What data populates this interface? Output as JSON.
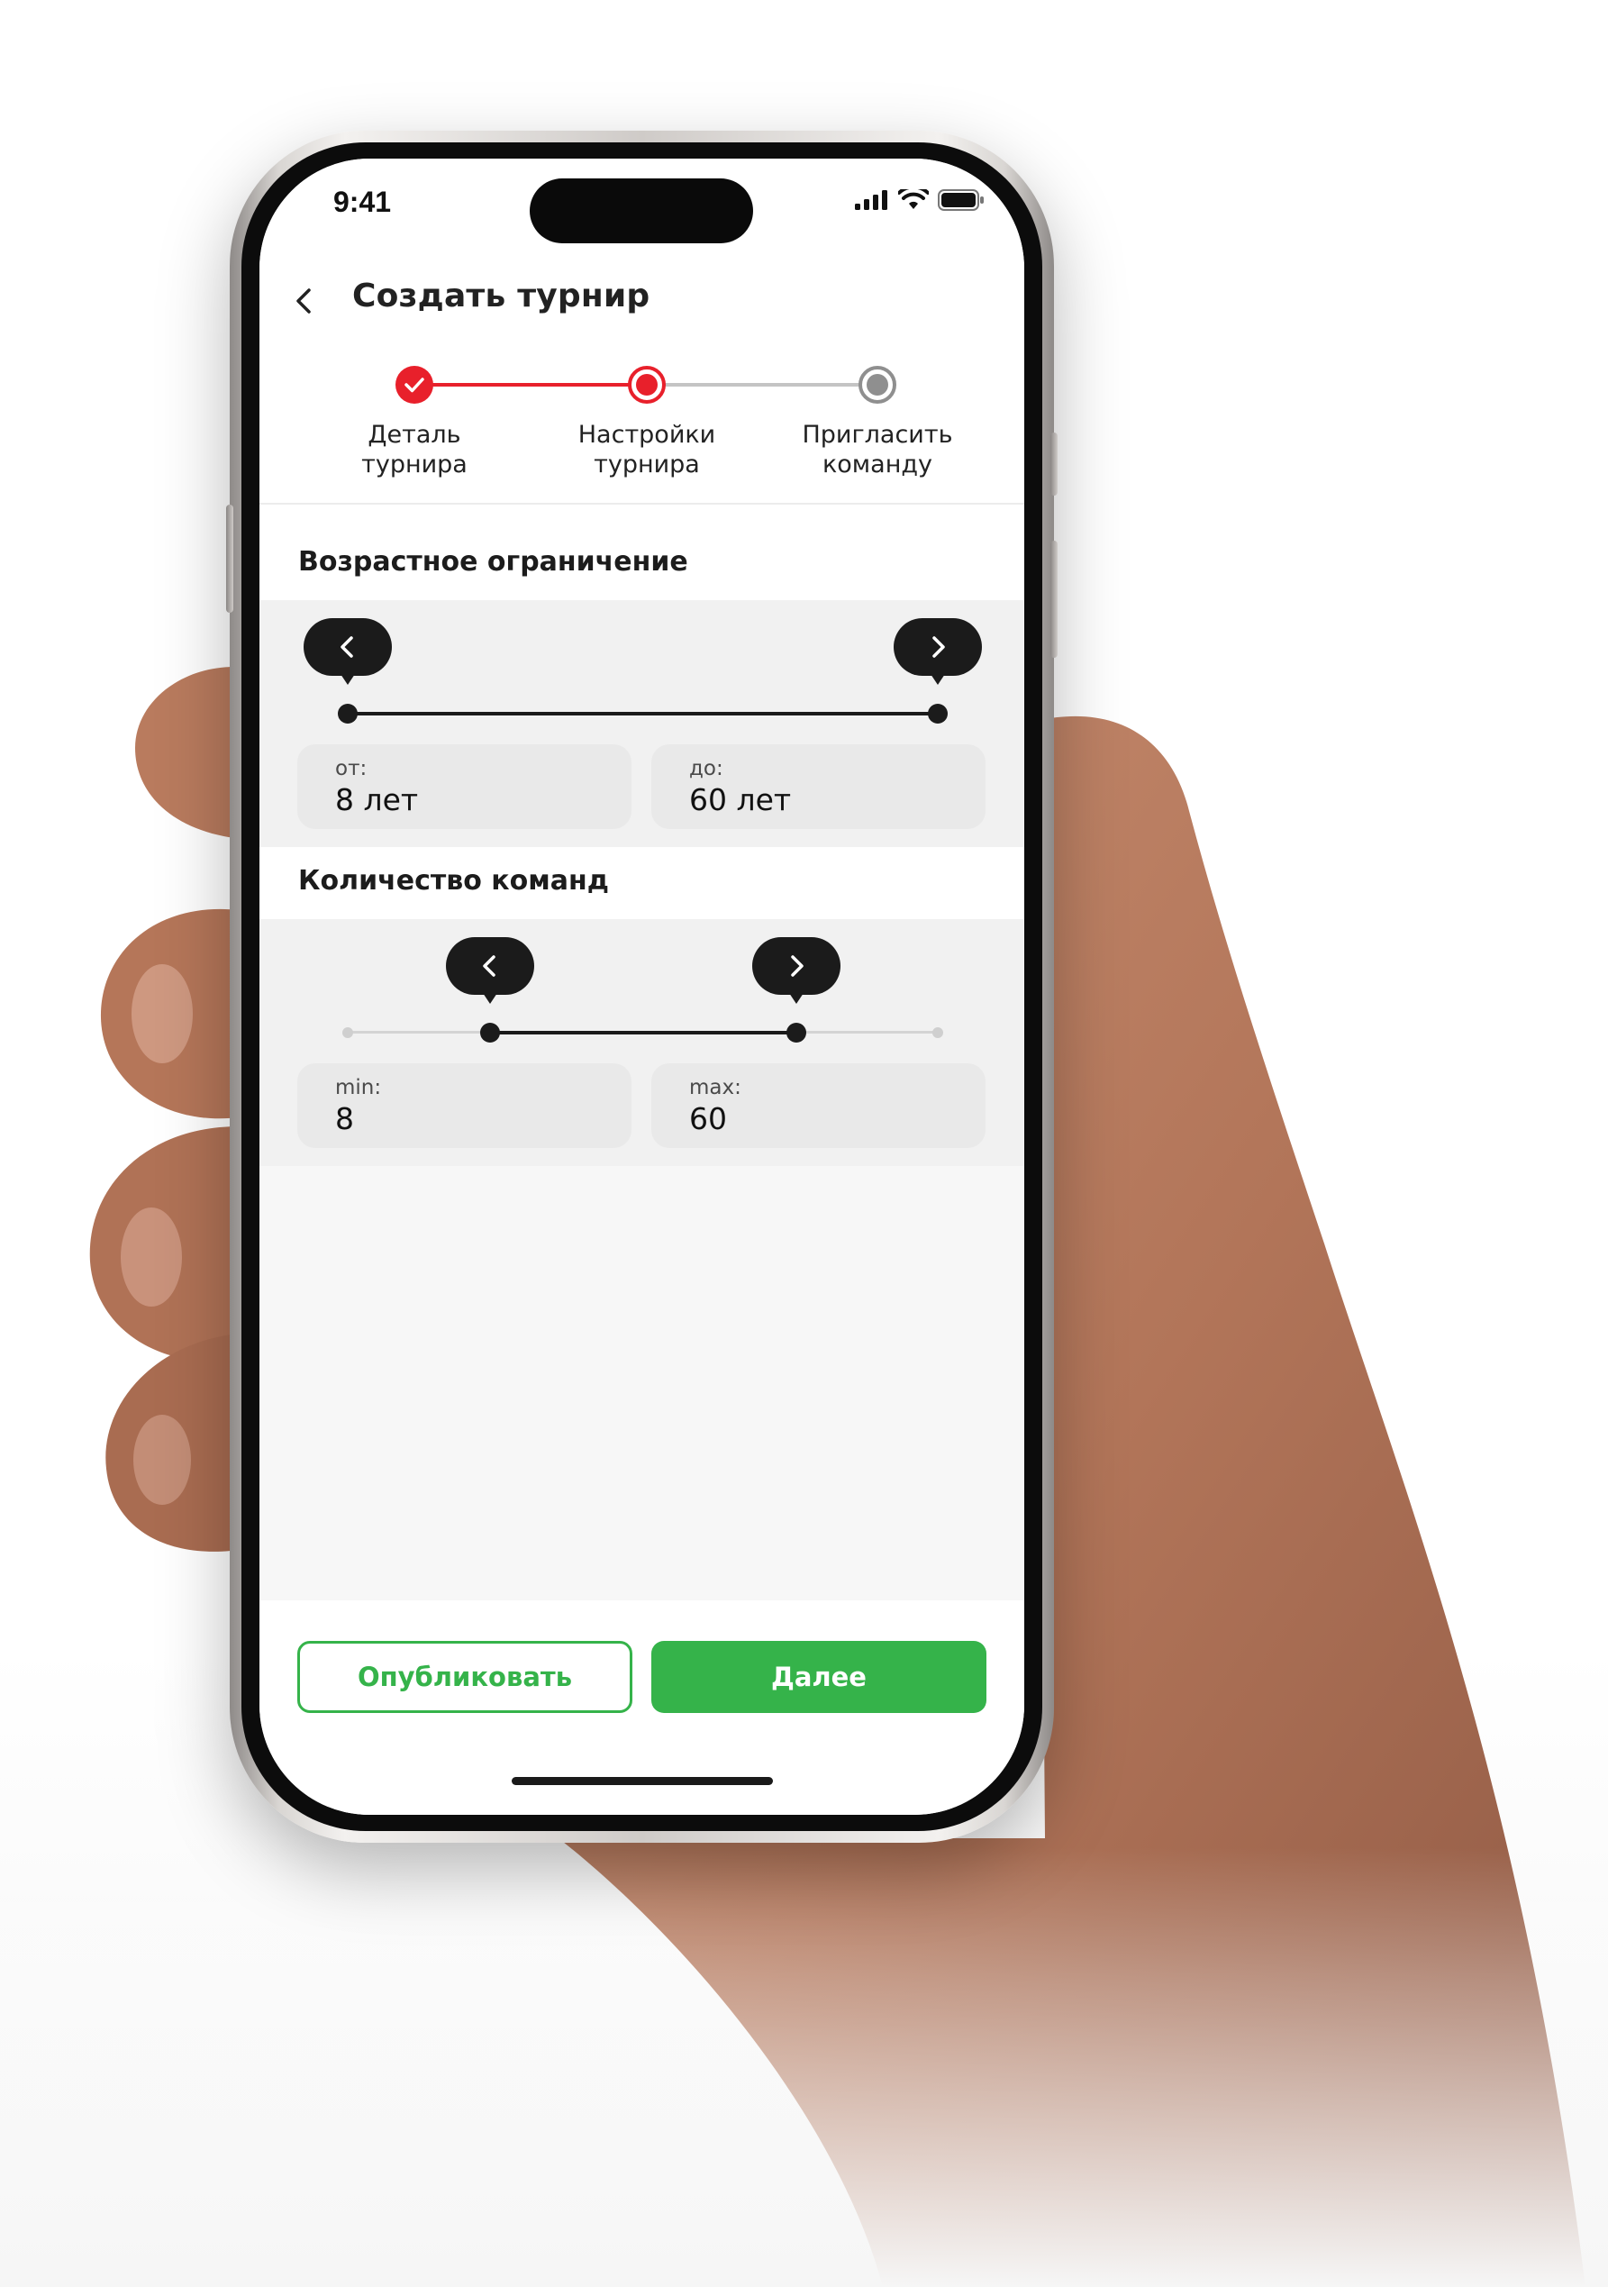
{
  "status_bar": {
    "time": "9:41"
  },
  "header": {
    "title": "Создать турнир",
    "back_icon": "chevron-left-icon"
  },
  "stepper": {
    "steps": [
      {
        "label": "Деталь\nтурнира",
        "state": "completed"
      },
      {
        "label": "Настройки\nтурнира",
        "state": "active"
      },
      {
        "label": "Пригласить\nкоманду",
        "state": "pending"
      }
    ],
    "colors": {
      "accent": "#e8202b",
      "pending": "#8f8f8f"
    }
  },
  "age_section": {
    "title": "Возрастное ограничение",
    "from_caption": "от:",
    "from_value": "8 лет",
    "to_caption": "до:",
    "to_value": "60 лет"
  },
  "teams_section": {
    "title": "Количество команд",
    "min_caption": "min:",
    "min_value": "8",
    "max_caption": "max:",
    "max_value": "60"
  },
  "actions": {
    "publish_label": "Опубликовать",
    "next_label": "Далее",
    "brand_color": "#35b34a"
  }
}
